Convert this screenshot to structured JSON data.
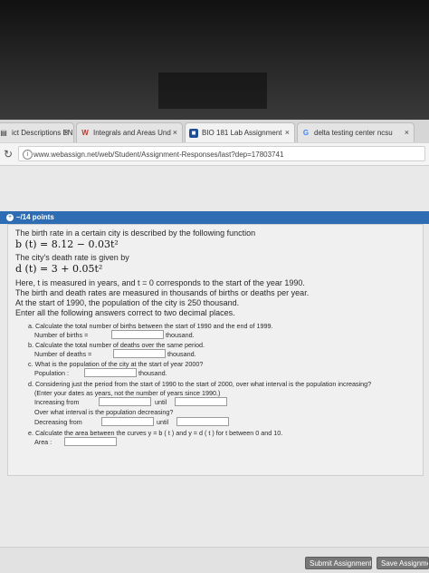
{
  "tabs": [
    {
      "label": "ict Descriptions EN",
      "icon": "document-icon"
    },
    {
      "label": "Integrals and Areas Und",
      "icon": "webassign-icon"
    },
    {
      "label": "BIO 181 Lab Assignment",
      "icon": "blackboard-icon"
    },
    {
      "label": "delta testing center ncsu",
      "icon": "google-icon"
    }
  ],
  "tab_close": "×",
  "address": {
    "url": "www.webassign.net/web/Student/Assignment-Responses/last?dep=17803741"
  },
  "question": {
    "points": "–/14 points",
    "intro": "The birth rate in a certain city is described by the following function",
    "birth_eq": "b (t) = 8.12 − 0.03t²",
    "death_intro": "The city's death rate is given by",
    "death_eq": "d (t) = 3 + 0.05t²",
    "line1": "Here, t is measured in years, and t = 0 corresponds to the start of the year 1990.",
    "line2": "The birth and death rates are measured in thousands of births or deaths per year.",
    "line3": "At the start of 1990, the population of the city is 250 thousand.",
    "line4": "Enter all the following answers correct to two decimal places."
  },
  "parts": {
    "a": {
      "prompt": "a. Calculate the total number of births between the start of 1990 and the end of 1999.",
      "label": "Number of births =",
      "unit": "thousand."
    },
    "b": {
      "prompt": "b. Calculate the total number of deaths over the same period.",
      "label": "Number of deaths =",
      "unit": "thousand."
    },
    "c": {
      "prompt": "c. What is the population of the city at the start of year 2000?",
      "label": "Population :",
      "unit": "thousand."
    },
    "d": {
      "prompt": "d. Considering just the period from the start of 1990 to the start of 2000, over what interval is the population increasing?",
      "hint": "(Enter your dates as years, not the number of years since 1990.)",
      "inc_label": "Increasing from",
      "until": "until",
      "dec_prompt": "Over what interval is the population decreasing?",
      "dec_label": "Decreasing from"
    },
    "e": {
      "prompt": "e. Calculate the area between the curves y = b ( t ) and y = d ( t ) for t between 0 and 10.",
      "label": "Area :"
    }
  },
  "buttons": {
    "submit": "Submit Assignment",
    "save": "Save Assignment"
  }
}
